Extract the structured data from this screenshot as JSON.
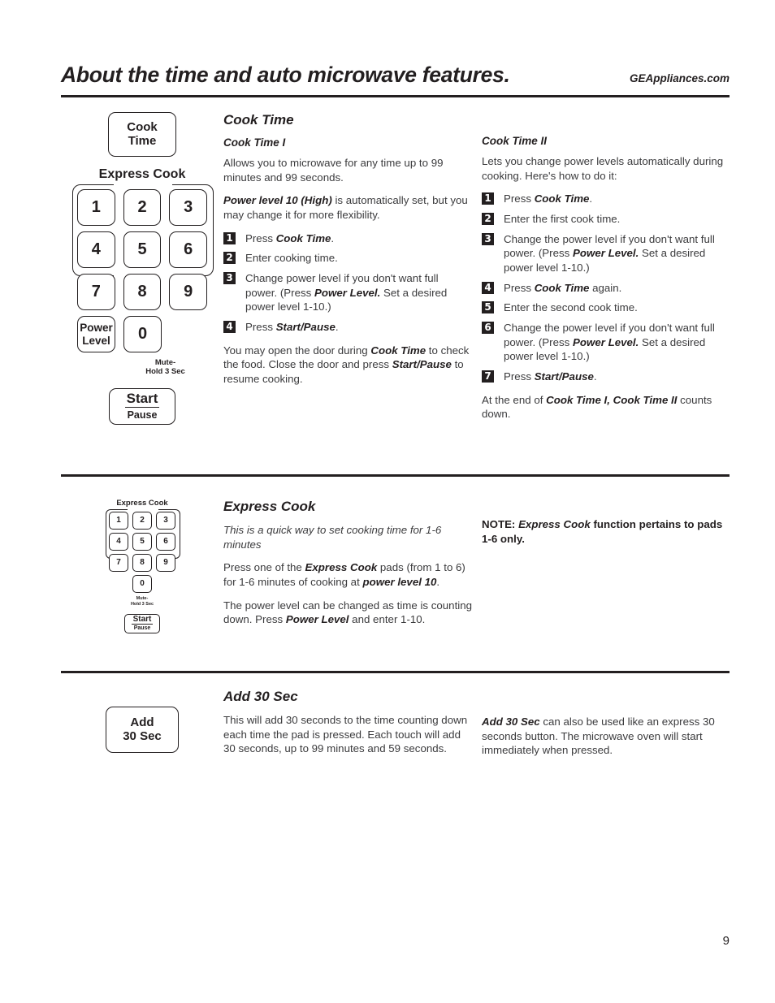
{
  "header": {
    "title": "About the time and auto microwave features.",
    "url": "GEAppliances.com"
  },
  "sections": [
    {
      "id": "cook-time",
      "art": {
        "cook_time_key": {
          "line1": "Cook",
          "line2": "Time"
        },
        "express_cook_label": "Express Cook",
        "keys": [
          "1",
          "2",
          "3",
          "4",
          "5",
          "6",
          "7",
          "8",
          "9"
        ],
        "power_level_key": {
          "line1": "Power",
          "line2": "Level"
        },
        "zero_key": "0",
        "mute_note": {
          "line1": "Mute-",
          "line2": "Hold 3 Sec"
        },
        "start_key": {
          "top": "Start",
          "bottom": "Pause"
        }
      },
      "title": "Cook Time",
      "col_a": {
        "subtitle": "Cook Time I",
        "intro": "Allows you to microwave for any time up to 99 minutes and 99 seconds.",
        "note_bold": "Power level 10 (High)",
        "note_rest": " is automatically set, but you may change it for more flexibility.",
        "steps": [
          {
            "n": "1",
            "pre": "Press ",
            "bold": "Cook Time",
            "post": "."
          },
          {
            "n": "2",
            "pre": "Enter cooking time.",
            "bold": "",
            "post": ""
          },
          {
            "n": "3",
            "pre": "Change power level if you don't want full power. (Press ",
            "bold": "Power Level.",
            "post": " Set a desired power level 1-10.)"
          },
          {
            "n": "4",
            "pre": "Press ",
            "bold": "Start/Pause",
            "post": "."
          }
        ],
        "closing_pre": "You may open the door during ",
        "closing_bold1": "Cook Time",
        "closing_mid": " to check the food. Close the door and press ",
        "closing_bold2": "Start/Pause",
        "closing_post": " to resume cooking."
      },
      "col_b": {
        "subtitle": "Cook Time II",
        "intro": "Lets you change power levels automatically during cooking. Here's how to do it:",
        "steps": [
          {
            "n": "1",
            "pre": "Press ",
            "bold": "Cook Time",
            "post": "."
          },
          {
            "n": "2",
            "pre": "Enter the first cook time.",
            "bold": "",
            "post": ""
          },
          {
            "n": "3",
            "pre": "Change the power level if you don't want full power. (Press ",
            "bold": "Power Level.",
            "post": " Set a desired power level 1-10.)"
          },
          {
            "n": "4",
            "pre": "Press ",
            "bold": "Cook Time",
            "post": " again."
          },
          {
            "n": "5",
            "pre": "Enter the second cook time.",
            "bold": "",
            "post": ""
          },
          {
            "n": "6",
            "pre": "Change the power level if you don't want full power. (Press ",
            "bold": "Power Level.",
            "post": " Set a desired power level 1-10.)"
          },
          {
            "n": "7",
            "pre": "Press ",
            "bold": "Start/Pause",
            "post": "."
          }
        ],
        "closing_pre": "At the end of ",
        "closing_bold": "Cook Time I, Cook Time II",
        "closing_post": " counts down."
      }
    },
    {
      "id": "express-cook",
      "art": {
        "express_cook_label": "Express Cook",
        "keys": [
          "1",
          "2",
          "3",
          "4",
          "5",
          "6",
          "7",
          "8",
          "9"
        ],
        "zero_key": "0",
        "mute_note": {
          "line1": "Mute-",
          "line2": "Hold 3 Sec"
        },
        "start_key": {
          "top": "Start",
          "bottom": "Pause"
        }
      },
      "title": "Express Cook",
      "col_a": {
        "intro_italic": "This is a quick way to set cooking time for 1-6 minutes",
        "p2_pre": "Press one of the ",
        "p2_bold1": "Express Cook",
        "p2_mid": " pads (from 1 to 6) for 1-6 minutes of cooking at ",
        "p2_bold2": "power level 10",
        "p2_post": ".",
        "p3_pre": "The power level can be changed as time is counting down. Press ",
        "p3_bold": "Power Level",
        "p3_post": " and enter 1-10."
      },
      "col_b": {
        "note_label": "NOTE: ",
        "note_bold_italic": "Express Cook",
        "note_rest": " function pertains to pads 1-6 only."
      }
    },
    {
      "id": "add-30-sec",
      "art": {
        "add_key": {
          "line1": "Add",
          "line2": "30 Sec"
        }
      },
      "title": "Add 30 Sec",
      "col_a": {
        "body": "This will add 30 seconds to the time counting down each time the pad is pressed. Each touch will add 30 seconds, up to 99 minutes and 59 seconds."
      },
      "col_b": {
        "pre_bold": "Add 30 Sec",
        "rest": " can also be used like an express 30 seconds button. The microwave oven will start immediately when pressed."
      }
    }
  ],
  "page_number": "9"
}
